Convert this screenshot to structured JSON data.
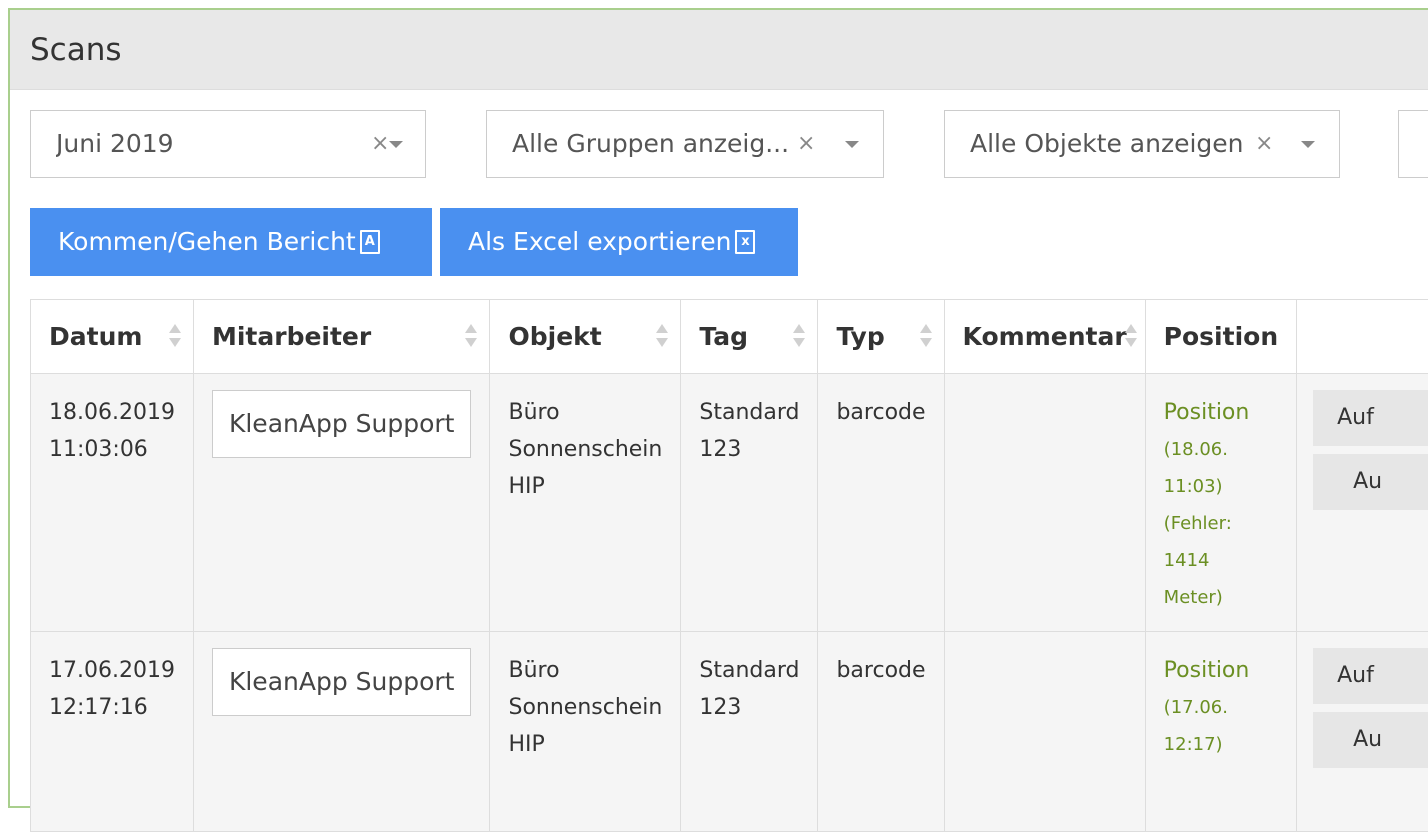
{
  "panel": {
    "title": "Scans"
  },
  "filters": {
    "month": {
      "value": "Juni 2019",
      "clear": "×"
    },
    "groups": {
      "value": "Alle Gruppen anzeig...",
      "clear": "×"
    },
    "objects": {
      "value": "Alle Objekte anzeigen",
      "clear": "×"
    }
  },
  "buttons": {
    "report": {
      "label": "Kommen/Gehen Bericht",
      "icon": "file-pdf-icon"
    },
    "excel": {
      "label": "Als Excel exportieren",
      "icon": "file-excel-icon"
    }
  },
  "table": {
    "columns": [
      "Datum",
      "Mitarbeiter",
      "Objekt",
      "Tag",
      "Typ",
      "Kommentar",
      "Position"
    ],
    "rows": [
      {
        "date": "18.06.2019",
        "time": "11:03:06",
        "employee": "KleanApp Support",
        "object": [
          "Büro",
          "Sonnenschein",
          "HIP"
        ],
        "tag": [
          "Standard",
          "123"
        ],
        "type": "barcode",
        "comment": "",
        "position": "Position",
        "position_details": [
          "(18.06.",
          "11:03)",
          "(Fehler:",
          "1414",
          "Meter)"
        ],
        "actions": [
          "Auf",
          "Au"
        ]
      },
      {
        "date": "17.06.2019",
        "time": "12:17:16",
        "employee": "KleanApp Support",
        "object": [
          "Büro",
          "Sonnenschein",
          "HIP"
        ],
        "tag": [
          "Standard",
          "123"
        ],
        "type": "barcode",
        "comment": "",
        "position": "Position",
        "position_details": [
          "(17.06.",
          "12:17)"
        ],
        "actions": [
          "Auf",
          "Au"
        ]
      }
    ]
  },
  "colors": {
    "primary_button": "#4a90f0",
    "position_link": "#6b8f23",
    "panel_border": "#a9cf8d",
    "header_bg": "#e8e8e8"
  }
}
